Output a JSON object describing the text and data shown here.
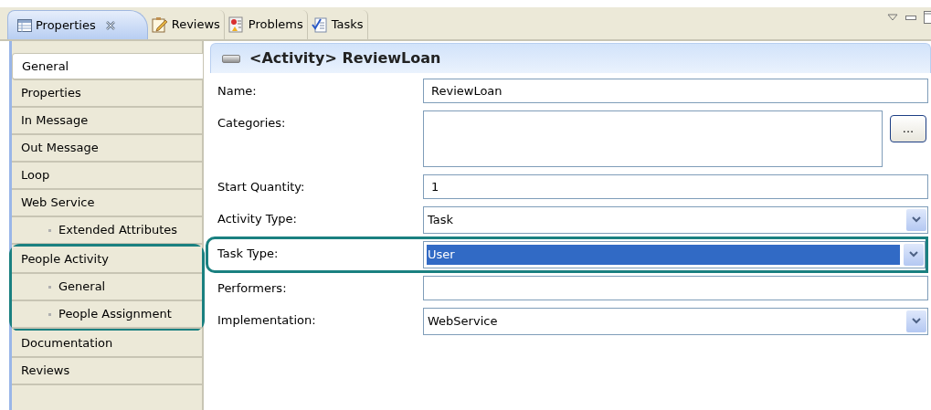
{
  "tabs": [
    {
      "label": "Properties",
      "selected": true,
      "closable": true
    },
    {
      "label": "Reviews",
      "selected": false,
      "closable": false
    },
    {
      "label": "Problems",
      "selected": false,
      "closable": false
    },
    {
      "label": "Tasks",
      "selected": false,
      "closable": false
    }
  ],
  "sidebar": {
    "items": [
      {
        "label": "General",
        "selected": true,
        "highlighted": false
      },
      {
        "label": "Properties",
        "selected": false,
        "highlighted": false
      },
      {
        "label": "In Message",
        "selected": false,
        "highlighted": false
      },
      {
        "label": "Out Message",
        "selected": false,
        "highlighted": false
      },
      {
        "label": "Loop",
        "selected": false,
        "highlighted": false
      },
      {
        "label": "Web Service",
        "selected": false,
        "highlighted": false,
        "children": [
          {
            "label": "Extended Attributes",
            "selected": false
          }
        ]
      },
      {
        "label": "People Activity",
        "selected": false,
        "highlighted": true,
        "children": [
          {
            "label": "General",
            "selected": false
          },
          {
            "label": "People Assignment",
            "selected": false
          }
        ]
      },
      {
        "label": "Documentation",
        "selected": false,
        "highlighted": false
      },
      {
        "label": "Reviews",
        "selected": false,
        "highlighted": false
      }
    ]
  },
  "panel": {
    "title": "<Activity> ReviewLoan",
    "fields": [
      {
        "kind": "text",
        "label": "Name:",
        "value": "ReviewLoan",
        "highlighted": false
      },
      {
        "kind": "list",
        "label": "Categories:",
        "button": "...",
        "highlighted": false
      },
      {
        "kind": "text",
        "label": "Start Quantity:",
        "value": "1",
        "highlighted": false
      },
      {
        "kind": "combo",
        "label": "Activity Type:",
        "value": "Task",
        "value_selected": false,
        "highlighted": false
      },
      {
        "kind": "combo",
        "label": "Task Type:",
        "value": "User",
        "value_selected": true,
        "highlighted": true
      },
      {
        "kind": "text",
        "label": "Performers:",
        "highlighted": false
      },
      {
        "kind": "combo",
        "label": "Implementation:",
        "value": "WebService",
        "value_selected": false,
        "highlighted": false
      }
    ]
  }
}
